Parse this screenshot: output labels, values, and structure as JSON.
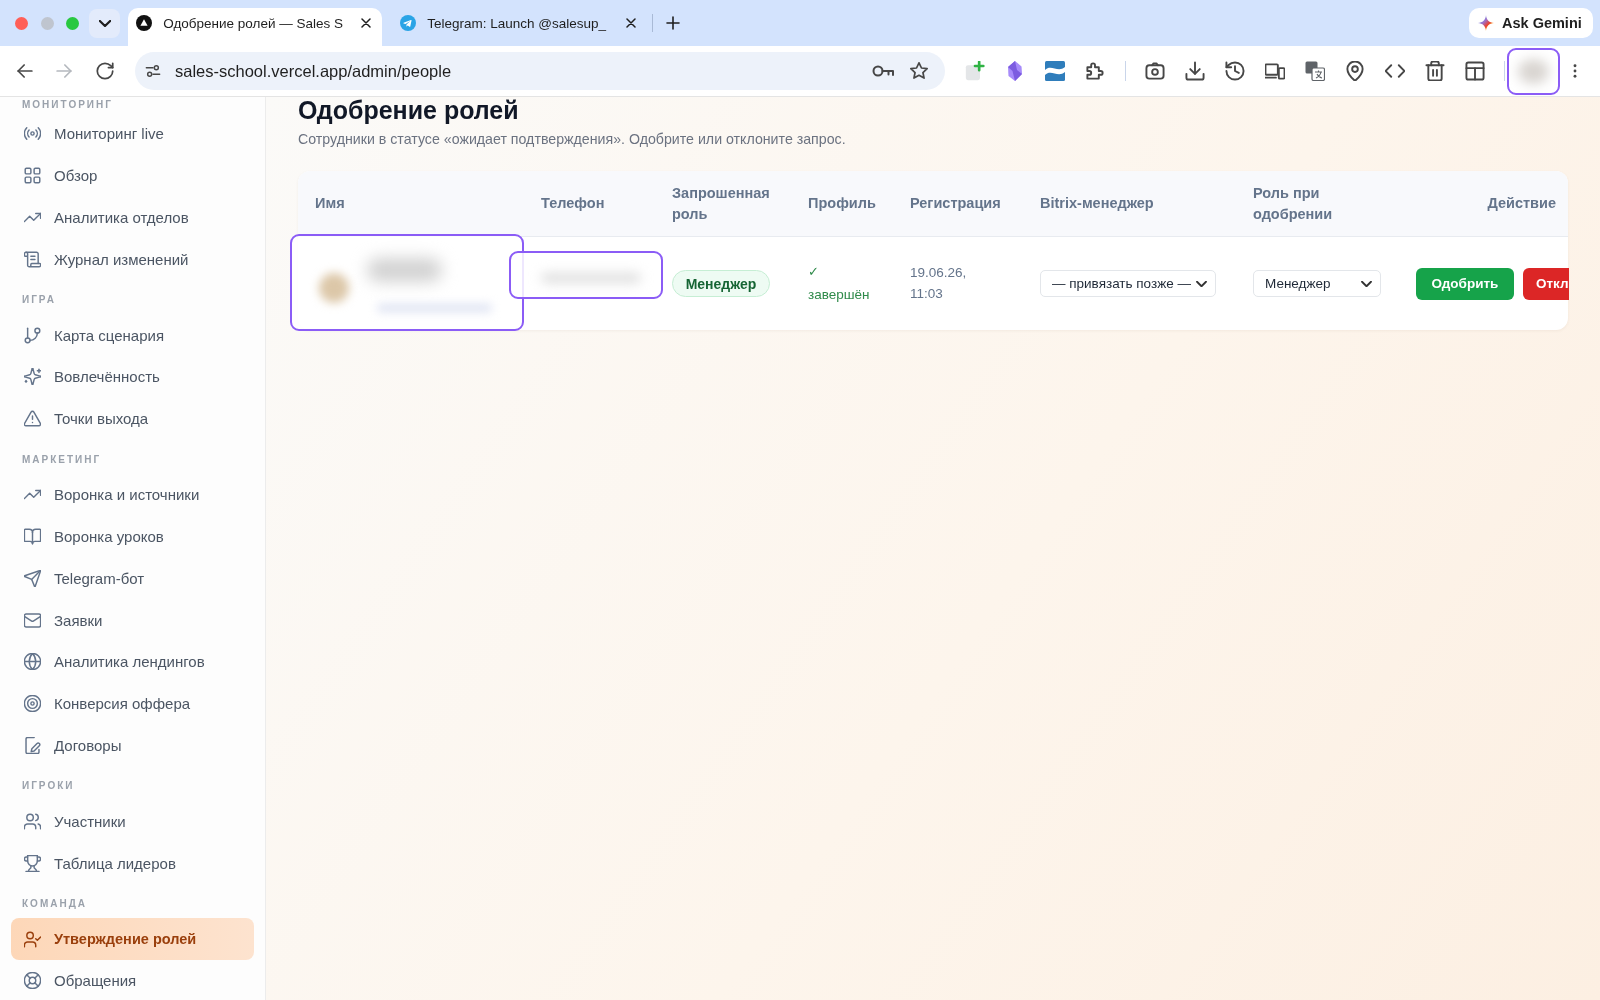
{
  "browser": {
    "tabs": [
      {
        "title": "Одобрение ролей — Sales S",
        "selected": true
      },
      {
        "title": "Telegram: Launch @salesup_",
        "selected": false
      }
    ],
    "gemini_button": "Ask Gemini",
    "forward_button": {
      "disabled": true
    },
    "address_bar": {
      "url": "sales-school.vercel.app/admin/people"
    }
  },
  "sidebar": {
    "sections": [
      {
        "heading": "МОНИТОРИНГ",
        "items": [
          {
            "label": "Мониторинг live",
            "selected": false
          },
          {
            "label": "Обзор",
            "selected": false
          },
          {
            "label": "Аналитика отделов",
            "selected": false
          },
          {
            "label": "Журнал изменений",
            "selected": false
          }
        ]
      },
      {
        "heading": "ИГРА",
        "items": [
          {
            "label": "Карта сценария",
            "selected": false
          },
          {
            "label": "Вовлечённость",
            "selected": false
          },
          {
            "label": "Точки выхода",
            "selected": false
          }
        ]
      },
      {
        "heading": "МАРКЕТИНГ",
        "items": [
          {
            "label": "Воронка и источники",
            "selected": false
          },
          {
            "label": "Воронка уроков",
            "selected": false
          },
          {
            "label": "Telegram-бот",
            "selected": false
          },
          {
            "label": "Заявки",
            "selected": false
          },
          {
            "label": "Аналитика лендингов",
            "selected": false
          },
          {
            "label": "Конверсия оффера",
            "selected": false
          },
          {
            "label": "Договоры",
            "selected": false
          }
        ]
      },
      {
        "heading": "ИГРОКИ",
        "items": [
          {
            "label": "Участники",
            "selected": false
          },
          {
            "label": "Таблица лидеров",
            "selected": false
          }
        ]
      },
      {
        "heading": "КОМАНДА",
        "items": [
          {
            "label": "Утверждение ролей",
            "selected": true
          },
          {
            "label": "Обращения",
            "selected": false
          }
        ]
      }
    ]
  },
  "page": {
    "title": "Одобрение ролей",
    "subtitle": "Сотрудники в статусе «ожидает подтверждения». Одобрите или отклоните запрос."
  },
  "table": {
    "columns": [
      "Имя",
      "Телефон",
      "Запрошенная роль",
      "Профиль",
      "Регистрация",
      "Bitrix-менеджер",
      "Роль при одобрении",
      "Действие"
    ],
    "rows": [
      {
        "requested_role": "Менеджер",
        "profile": {
          "mark": "✓",
          "status": "завершён"
        },
        "registered": "19.06.26, 11:03",
        "bitrix_manager": "— привязать позже —",
        "approval_role": "Менеджер",
        "actions": [
          {
            "label": "Одобрить",
            "kind": "approve"
          },
          {
            "label": "Откл",
            "kind": "reject"
          }
        ]
      }
    ]
  }
}
